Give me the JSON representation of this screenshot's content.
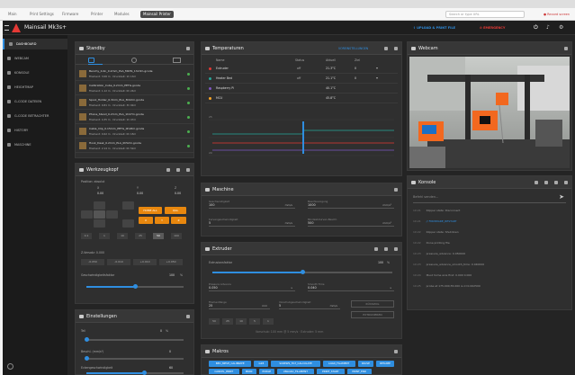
{
  "browser": {
    "tabs": [
      "Main",
      "Print Settings",
      "Firmware",
      "Printer",
      "Modules",
      "Mainsail Printer"
    ],
    "active_tab": 5,
    "url_placeholder": "Search or type URL",
    "record_label": "Record screen"
  },
  "app": {
    "printer_name": "Mainsail Mk3s+",
    "top_buttons": {
      "upload": "UPLOAD & PRINT FILE",
      "emergency": "EMERGENCY"
    },
    "accent": "#2f8ee0",
    "warn": "#e8870e",
    "emergency_color": "#e53935"
  },
  "sidebar": {
    "items": [
      {
        "label": "DASHBOARD",
        "icon": "dashboard-icon"
      },
      {
        "label": "WEBCAM",
        "icon": "webcam-icon"
      },
      {
        "label": "KONSOLE",
        "icon": "console-icon"
      },
      {
        "label": "HEIGHTMAP",
        "icon": "heightmap-icon"
      },
      {
        "label": "G-CODE DATEIEN",
        "icon": "gcode-files-icon"
      },
      {
        "label": "G-CODE BETRACHTER",
        "icon": "gcode-viewer-icon"
      },
      {
        "label": "HISTORY",
        "icon": "history-icon"
      },
      {
        "label": "MASCHINE",
        "icon": "machine-icon"
      }
    ],
    "active_index": 0
  },
  "standby": {
    "title": "Standby",
    "files": [
      {
        "name": "Benchy_0.4n_0.2mm_PLA_MK3S_1h13m.gcode",
        "meta": "Filament: 3.06 m · Druckzeit: 1h 13m"
      },
      {
        "name": "Calibration_Cube_0.2mm_PETG.gcode",
        "meta": "Filament: 1.12 m · Druckzeit: 0h 24m"
      },
      {
        "name": "Spool_Holder_0.3mm_PLA_3h02m.gcode",
        "meta": "Filament: 9.81 m · Druckzeit: 3h 02m"
      },
      {
        "name": "Phone_Stand_0.2mm_PLA_1h47m.gcode",
        "meta": "Filament: 4.35 m · Druckzeit: 1h 47m"
      },
      {
        "name": "Cable_Clip_0.15mm_PETG_0h18m.gcode",
        "meta": "Filament: 0.62 m · Druckzeit: 0h 18m"
      },
      {
        "name": "Hook_Desk_0.2mm_PLA_0h52m.gcode",
        "meta": "Filament: 2.14 m · Druckzeit: 0h 52m"
      }
    ]
  },
  "toolhead": {
    "title": "Werkzeugkopf",
    "position_label": "Position: absolut",
    "axes": [
      {
        "axis": "X",
        "value": "0.00"
      },
      {
        "axis": "Y",
        "value": "0.00"
      },
      {
        "axis": "Z",
        "value": "0.00"
      }
    ],
    "home_all": "HOME ALL",
    "home_x": "X",
    "home_y": "Y",
    "home_z": "Z",
    "qgl": "QGL",
    "steps": [
      "0.1",
      "1",
      "10",
      "25",
      "50",
      "100"
    ],
    "selected_step": 4,
    "z_offset_label": "Z-Versatz: 0.000",
    "z_offset_buttons": [
      "-0.050",
      "-0.010",
      "+0.010",
      "+0.050"
    ],
    "speed_label": "Geschwindigkeitsfaktor",
    "speed_value": "100",
    "speed_unit": "%",
    "speed_fraction": 0.5
  },
  "settings_panel": {
    "title": "Einstellungen",
    "fan": {
      "label": "Teil",
      "value": "0",
      "unit": "%",
      "fraction": 0.0
    },
    "accel_label": "Beschl. (mm/s²)",
    "accel_value": "0",
    "accel_fraction": 0.0,
    "cornering_label": "Eckengeschwindigkeit",
    "cornering_value": "60",
    "cornering_fraction": 0.6
  },
  "temperatures": {
    "title": "Temperaturen",
    "preset_label": "VOREINSTELLUNGEN",
    "headers": [
      "Name",
      "Status",
      "Aktuell",
      "Ziel"
    ],
    "rows": [
      {
        "name": "Extruder",
        "color": "#e53935",
        "status": "off",
        "current": "21.3°C",
        "target": "0"
      },
      {
        "name": "Heater Bed",
        "color": "#26a69a",
        "status": "off",
        "current": "21.1°C",
        "target": "0"
      },
      {
        "name": "Raspberry Pi",
        "color": "#7e57c2",
        "status": "",
        "current": "40.1°C",
        "target": ""
      },
      {
        "name": "MCU",
        "color": "#ffa726",
        "status": "",
        "current": "45.8°C",
        "target": ""
      }
    ],
    "chart_ticks": [
      "20",
      "25"
    ]
  },
  "maschine": {
    "title": "Maschine",
    "fields": [
      {
        "label": "Geschwindigkeit",
        "value": "100",
        "unit": "mm/s"
      },
      {
        "label": "Beschleunigung",
        "value": "1000",
        "unit": "mm/s²"
      },
      {
        "label": "Kurvengeschwindigkeit",
        "value": "5",
        "unit": "mm/s"
      },
      {
        "label": "Mindest-Kurven-Beschl.",
        "value": "500",
        "unit": "mm/s²"
      }
    ]
  },
  "extruder": {
    "title": "Extruder",
    "flow_label": "Extrusionsfaktor",
    "flow_value": "100",
    "flow_unit": "%",
    "flow_fraction": 0.5,
    "pa_label": "Pressure Advance",
    "pa_value": "0.050",
    "pa_unit": "s",
    "smooth_label": "Smooth Time",
    "smooth_value": "0.040",
    "smooth_unit": "s",
    "length_label": "Filamentlänge",
    "length_value": "25",
    "length_unit": "mm",
    "feed_label": "Vorschubgeschwindigkeit",
    "feed_value": "5",
    "feed_unit": "mm/s",
    "retract": "RÜCKZUG",
    "extrude": "EXTRUDIEREN",
    "amounts": [
      "50",
      "25",
      "10",
      "5",
      "1"
    ],
    "hint": "Vorschub: 100 mm @ 5 mm/s · Extruder: 5 mm"
  },
  "macros": {
    "title": "Makros",
    "items": [
      "BED_MESH_CALIBRATE",
      "G28",
      "SCREWS_TILT_CALCULATE",
      "LOAD_FILAMENT",
      "PAUSE",
      "RESUME",
      "CANCEL_PRINT",
      "M600",
      "PURGE",
      "UNLOAD_FILAMENT",
      "PRINT_START",
      "PRINT_END",
      "TIMELAPSE",
      "HOME_Z",
      "Z_TILT_ADJUST",
      "PARK_HEAD",
      "NOZZLE_CLEAN"
    ]
  },
  "webcam": {
    "title": "Webcam"
  },
  "console": {
    "title": "Konsole",
    "placeholder": "Befehl senden...",
    "lines": [
      {
        "time": "10:21",
        "text": "Klipper state: Disconnect"
      },
      {
        "time": "10:21",
        "text": "// FIRMWARE_RESTART"
      },
      {
        "time": "10:22",
        "text": "Klipper state: Shutdown"
      },
      {
        "time": "10:22",
        "text": "Done printing file"
      },
      {
        "time": "10:23",
        "text": "pressure_advance: 0.050000"
      },
      {
        "time": "10:23",
        "text": "pressure_advance_smooth_time: 0.040000"
      },
      {
        "time": "10:24",
        "text": "Must home axis first: 0.000 0.000"
      },
      {
        "time": "10:25",
        "text": "probe at 175.000,55.000 is z=0.002500"
      }
    ]
  }
}
